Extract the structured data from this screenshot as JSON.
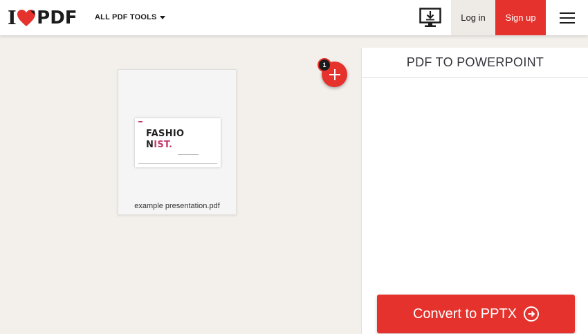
{
  "header": {
    "logo_letter": "I",
    "logo_text": "PDF",
    "tools_menu_label": "ALL PDF TOOLS",
    "login_label": "Log in",
    "signup_label": "Sign up"
  },
  "file": {
    "count": "1",
    "name": "example presentation.pdf",
    "thumb_line1": "FASHIO",
    "thumb_line2_a": "N",
    "thumb_line2_b": "IST."
  },
  "panel": {
    "title": "PDF TO POWERPOINT",
    "convert_label": "Convert to PPTX"
  },
  "colors": {
    "brand_red": "#e5322d",
    "thumb_accent": "#c43a6d",
    "workspace_bg": "#f3f0ec"
  },
  "icons": [
    "heart-logo-icon",
    "caret-down-icon",
    "desktop-download-icon",
    "hamburger-menu-icon",
    "plus-icon",
    "arrow-right-circle-icon"
  ]
}
